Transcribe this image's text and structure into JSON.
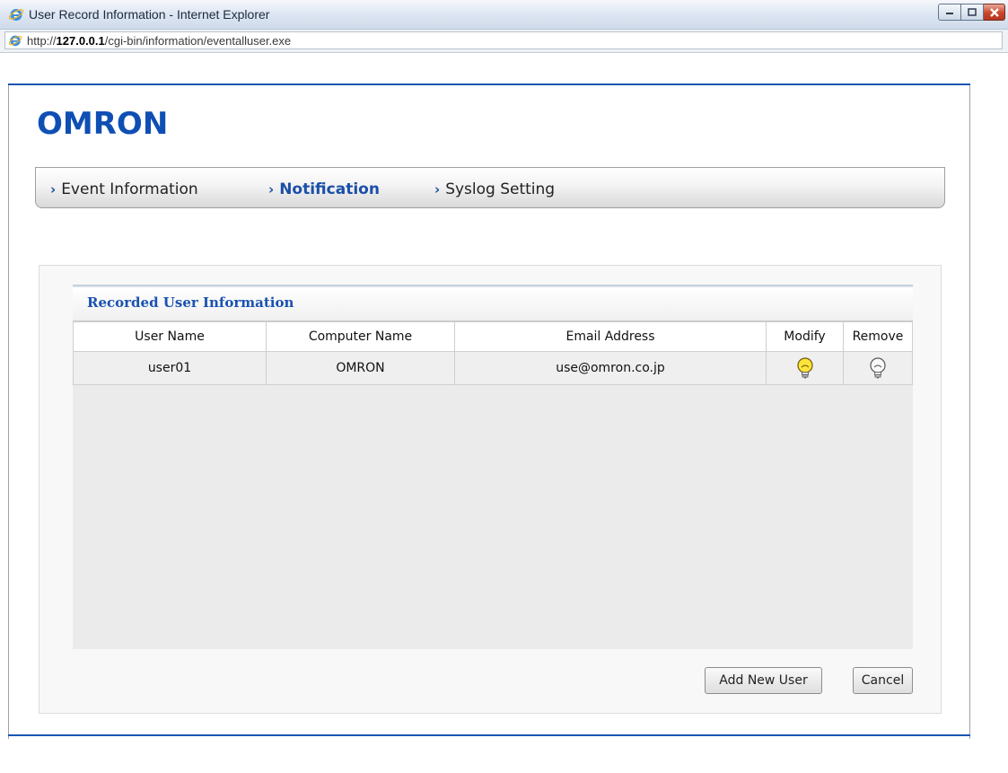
{
  "window": {
    "title": "User Record Information - Internet Explorer",
    "url_prefix": "http://",
    "url_host": "127.0.0.1",
    "url_path": "/cgi-bin/information/eventalluser.exe"
  },
  "brand": {
    "logo_text": "OMRON",
    "color": "#0f4fb4"
  },
  "nav": {
    "items": [
      {
        "label": "Event Information",
        "active": false
      },
      {
        "label": "Notification",
        "active": true
      },
      {
        "label": "Syslog Setting",
        "active": false
      }
    ]
  },
  "section": {
    "title": "Recorded User Information"
  },
  "table": {
    "headers": [
      "User Name",
      "Computer Name",
      "Email Address",
      "Modify",
      "Remove"
    ],
    "rows": [
      {
        "user_name": "user01",
        "computer_name": "OMRON",
        "email": "use@omron.co.jp",
        "modify_icon": "lightbulb-on-icon",
        "remove_icon": "lightbulb-off-icon"
      }
    ]
  },
  "buttons": {
    "add_new_user": "Add New User",
    "cancel": "Cancel"
  }
}
